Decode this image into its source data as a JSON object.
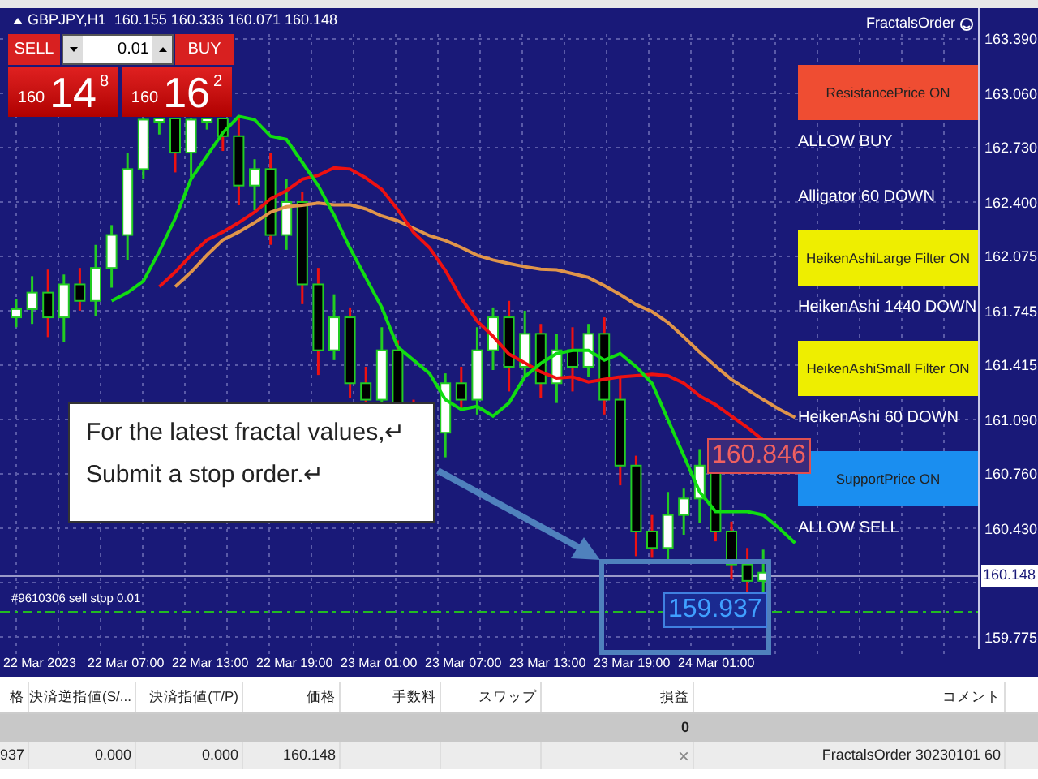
{
  "chart_header": {
    "symbol_info": "GBPJPY,H1  160.155 160.336 160.071 160.148",
    "expert_name": "FractalsOrder"
  },
  "trade_panel": {
    "sell_label": "SELL",
    "buy_label": "BUY",
    "lot": "0.01",
    "sell_price": {
      "prefix": "160",
      "main": "14",
      "suffix": "8"
    },
    "buy_price": {
      "prefix": "160",
      "main": "16",
      "suffix": "2"
    }
  },
  "status_panels": [
    {
      "kind": "box",
      "text": "ResistancePrice ON",
      "color": "#ef4d32"
    },
    {
      "kind": "label",
      "text": "ALLOW BUY"
    },
    {
      "kind": "label",
      "text": "Alligator 60 DOWN"
    },
    {
      "kind": "box",
      "text": "HeikenAshiLarge Filter ON",
      "color": "#eeee00"
    },
    {
      "kind": "label",
      "text": "HeikenAshi 1440 DOWN"
    },
    {
      "kind": "box",
      "text": "HeikenAshiSmall Filter ON",
      "color": "#eeee00"
    },
    {
      "kind": "label",
      "text": "HeikenAshi 60 DOWN"
    },
    {
      "kind": "box",
      "text": "SupportPrice ON",
      "color": "#1a8ef0"
    },
    {
      "kind": "label",
      "text": "ALLOW SELL"
    }
  ],
  "callout": {
    "lines": [
      "For the latest fractal values,↵",
      "Submit a stop order.↵"
    ]
  },
  "order_line_label": "#9610306 sell stop 0.01",
  "price_labels": {
    "upper": "160.846",
    "lower": "159.937"
  },
  "price_axis": {
    "ticks": [
      "163.390",
      "163.060",
      "162.730",
      "162.400",
      "162.075",
      "161.745",
      "161.415",
      "161.090",
      "160.760",
      "160.430",
      "159.775"
    ],
    "current_price": "160.148"
  },
  "time_axis": [
    "22 Mar 2023",
    "22 Mar 07:00",
    "22 Mar 13:00",
    "22 Mar 19:00",
    "23 Mar 01:00",
    "23 Mar 07:00",
    "23 Mar 13:00",
    "23 Mar 19:00",
    "24 Mar 01:00"
  ],
  "table": {
    "columns": [
      "格",
      "決済逆指値(S/...",
      "決済指値(T/P)",
      "価格",
      "手数料",
      "スワップ",
      "損益",
      "コメント"
    ],
    "summary": {
      "profit": "0"
    },
    "rows": [
      {
        "cells": [
          "937",
          "0.000",
          "0.000",
          "160.148",
          "",
          "",
          "×",
          "FractalsOrder 30230101 60"
        ]
      }
    ]
  }
}
